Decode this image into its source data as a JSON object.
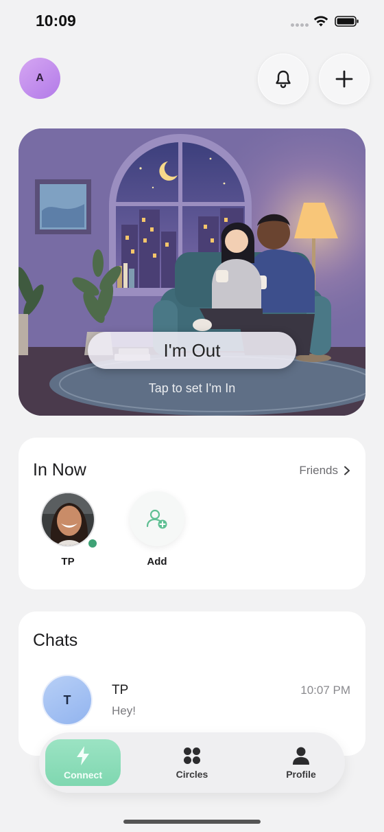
{
  "status_bar": {
    "time": "10:09"
  },
  "header": {
    "avatar_initial": "A"
  },
  "hero": {
    "status_label": "I'm Out",
    "hint": "Tap to set I'm In"
  },
  "in_now": {
    "title": "In Now",
    "friends_link": "Friends",
    "friends": [
      {
        "label": "TP",
        "online": true
      }
    ],
    "add_label": "Add"
  },
  "chats": {
    "title": "Chats",
    "items": [
      {
        "avatar_initial": "T",
        "name": "TP",
        "time": "10:07 PM",
        "preview": "Hey!"
      }
    ]
  },
  "nav": {
    "items": [
      {
        "label": "Connect",
        "icon": "bolt-icon",
        "active": true
      },
      {
        "label": "Circles",
        "icon": "circles-icon",
        "active": false
      },
      {
        "label": "Profile",
        "icon": "person-icon",
        "active": false
      }
    ]
  },
  "colors": {
    "online": "#3fa276",
    "connect_active": "#8adcb8",
    "avatar_me": "#c08ded",
    "chat_avatar": "#a6c3f3"
  }
}
